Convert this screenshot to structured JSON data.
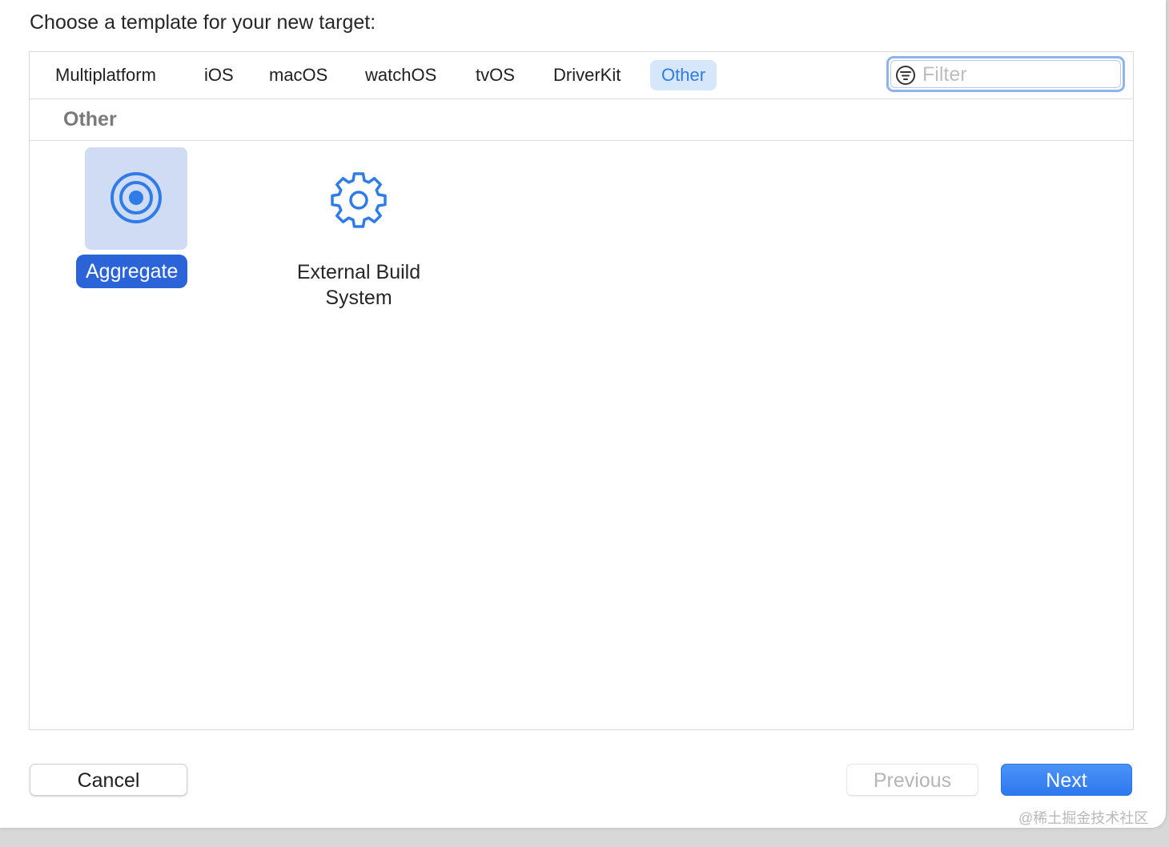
{
  "dialog": {
    "title": "Choose a template for your new target:"
  },
  "tabs": [
    {
      "label": "Multiplatform",
      "active": false
    },
    {
      "label": "iOS",
      "active": false
    },
    {
      "label": "macOS",
      "active": false
    },
    {
      "label": "watchOS",
      "active": false
    },
    {
      "label": "tvOS",
      "active": false
    },
    {
      "label": "DriverKit",
      "active": false
    },
    {
      "label": "Other",
      "active": true
    }
  ],
  "filter": {
    "placeholder": "Filter",
    "value": "",
    "icon": "filter-icon"
  },
  "section": {
    "title": "Other"
  },
  "templates": [
    {
      "label": "Aggregate",
      "icon": "target-icon",
      "selected": true
    },
    {
      "label_line1": "External Build",
      "label_line2": "System",
      "icon": "gear-icon",
      "selected": false
    }
  ],
  "buttons": {
    "cancel": "Cancel",
    "previous": "Previous",
    "next": "Next"
  },
  "colors": {
    "accent": "#2f7be8",
    "selection": "#2a64d8",
    "tab_active_bg": "#d6e6fb"
  },
  "watermark": "@稀土掘金技术社区"
}
